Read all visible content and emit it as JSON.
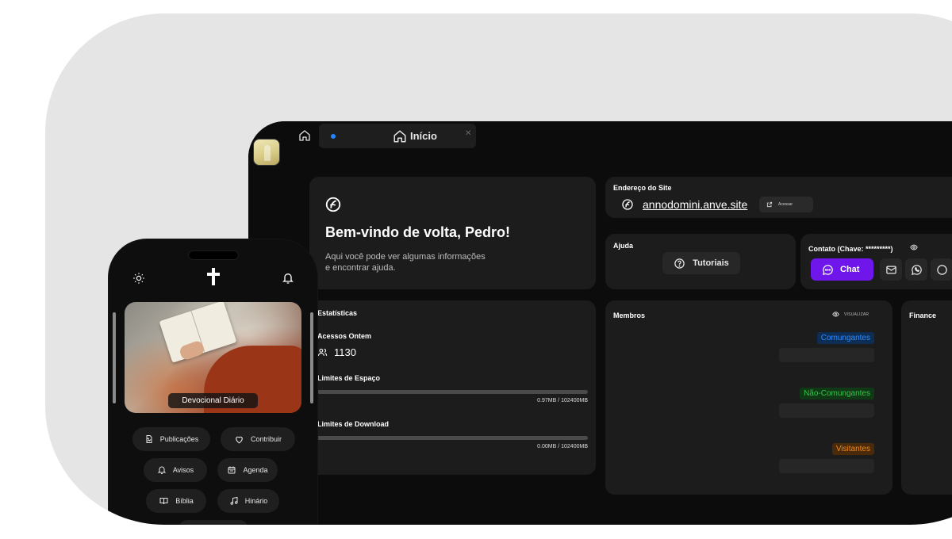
{
  "desktop": {
    "tab": {
      "label": "Início"
    },
    "welcome": {
      "title": "Bem-vindo de volta, Pedro!",
      "line1": "Aqui você pode ver algumas informações",
      "line2": "e encontrar ajuda."
    },
    "site": {
      "label": "Endereço do Site",
      "url": "annodomini.anve.site",
      "access_label": "Acessar"
    },
    "help": {
      "label": "Ajuda",
      "tutorials_label": "Tutoriais"
    },
    "contact": {
      "label": "Contato (Chave: *********)",
      "chat_label": "Chat",
      "accent": "#6f17ea"
    },
    "stats": {
      "title": "Estatísticas",
      "visits_label": "Acessos Ontem",
      "visits_value": "1130",
      "space_label": "Limites de Espaço",
      "space_value": "0.97MB / 102400MB",
      "space_fraction": 9.5e-06,
      "download_label": "Limites de Download",
      "download_value": "0.00MB / 102400MB",
      "download_fraction": 0
    },
    "members": {
      "title": "Membros",
      "view_label": "VISUALIZAR",
      "groups": [
        {
          "label": "Comungantes",
          "color": "#2f8cff"
        },
        {
          "label": "Não-Comungantes",
          "color": "#38c24c"
        },
        {
          "label": "Visitantes",
          "color": "#f08a1c"
        }
      ]
    },
    "finance": {
      "title": "Finance"
    }
  },
  "phone": {
    "hero_caption": "Devocional Diário",
    "menu": [
      {
        "label": "Publicações",
        "icon": "file-image-icon"
      },
      {
        "label": "Contribuir",
        "icon": "heart-icon"
      },
      {
        "label": "Avisos",
        "icon": "bell-icon"
      },
      {
        "label": "Agenda",
        "icon": "calendar-icon"
      },
      {
        "label": "Bíblia",
        "icon": "book-open-icon"
      },
      {
        "label": "Hinário",
        "icon": "music-icon"
      }
    ]
  }
}
